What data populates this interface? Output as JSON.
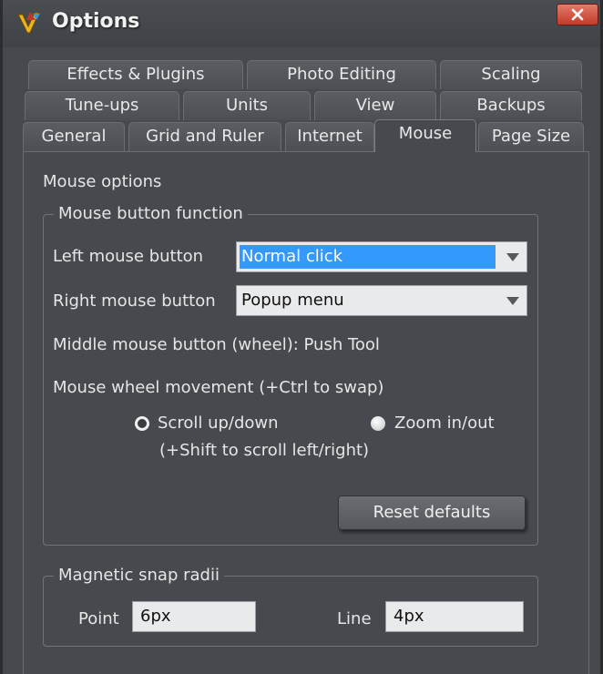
{
  "window": {
    "title": "Options",
    "close_icon": "close-icon"
  },
  "tabs": {
    "row1": [
      "Effects & Plugins",
      "Photo Editing",
      "Scaling"
    ],
    "row2": [
      "Tune-ups",
      "Units",
      "View",
      "Backups"
    ],
    "row3": [
      "General",
      "Grid and Ruler",
      "Internet",
      "Mouse",
      "Page Size"
    ],
    "active": "Mouse"
  },
  "mouse": {
    "section_title": "Mouse options",
    "button_group": {
      "legend": "Mouse button function",
      "left_label": "Left mouse button",
      "left_value": "Normal click",
      "right_label": "Right mouse button",
      "right_value": "Popup menu",
      "middle_text": "Middle mouse button (wheel): Push Tool",
      "wheel_label": "Mouse wheel movement (+Ctrl to swap)",
      "scroll_option": "Scroll up/down",
      "scroll_hint": "(+Shift to scroll left/right)",
      "zoom_option": "Zoom in/out",
      "selected_wheel": "scroll",
      "reset_label": "Reset defaults"
    },
    "snap_group": {
      "legend": "Magnetic snap radii",
      "point_label": "Point",
      "point_value": "6px",
      "line_label": "Line",
      "line_value": "4px"
    }
  },
  "colors": {
    "selection": "#3399ff",
    "background": "#464a4e",
    "close_button": "#c23a28"
  }
}
